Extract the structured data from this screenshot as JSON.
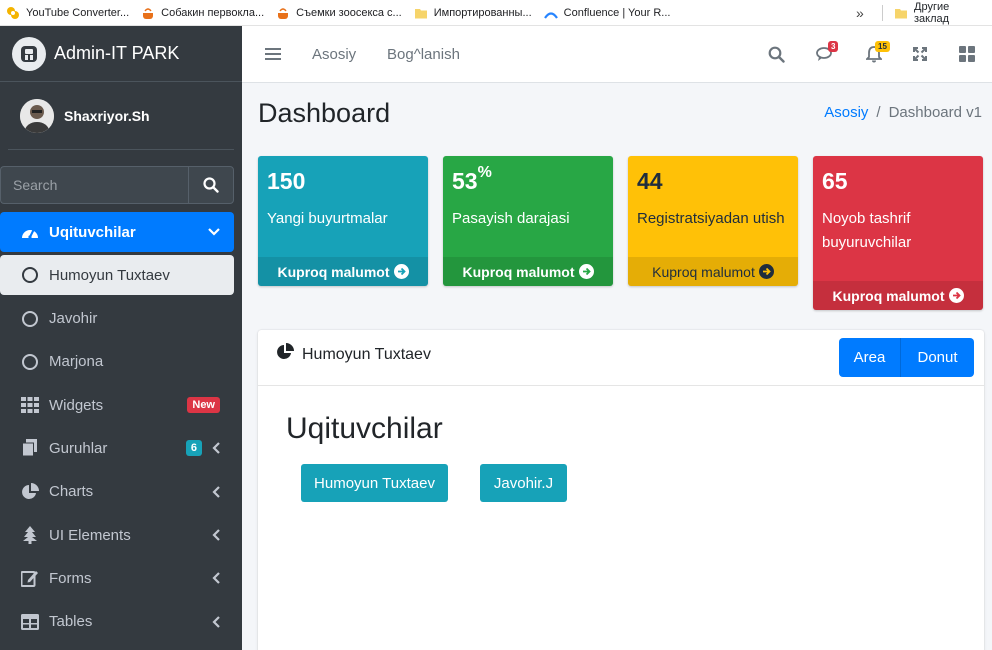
{
  "bookmarks": [
    {
      "label": "YouTube Converter...",
      "icon": "youtube-converter-icon"
    },
    {
      "label": "Собакин первокла...",
      "icon": "cooking-pot-icon"
    },
    {
      "label": "Съемки зоосекса с...",
      "icon": "cooking-pot-icon"
    },
    {
      "label": "Импортированны...",
      "icon": "folder-icon"
    },
    {
      "label": "Confluence | Your R...",
      "icon": "confluence-icon"
    }
  ],
  "bookmarks_more": "»",
  "bookmarks_other": "Другие заклад",
  "brand": {
    "name": "Admin-IT PARK"
  },
  "user": {
    "name": "Shaxriyor.Sh"
  },
  "search": {
    "placeholder": "Search"
  },
  "sidebar": {
    "items": [
      {
        "label": "Uqituvchilar",
        "icon": "tachometer-icon",
        "state": "active"
      },
      {
        "label": "Humoyun Tuxtaev",
        "icon": "circle-icon",
        "state": "sub-active"
      },
      {
        "label": "Javohir",
        "icon": "circle-icon"
      },
      {
        "label": "Marjona",
        "icon": "circle-icon"
      },
      {
        "label": "Widgets",
        "icon": "th-grid-icon",
        "badge": "New"
      },
      {
        "label": "Guruhlar",
        "icon": "copy-icon",
        "badge": "6"
      },
      {
        "label": "Charts",
        "icon": "pie-chart-icon"
      },
      {
        "label": "UI Elements",
        "icon": "tree-icon"
      },
      {
        "label": "Forms",
        "icon": "edit-icon"
      },
      {
        "label": "Tables",
        "icon": "table-icon"
      }
    ]
  },
  "topnav": {
    "links": [
      "Asosiy",
      "Bog^lanish"
    ],
    "messages_count": "3",
    "notifications_count": "15"
  },
  "page": {
    "title": "Dashboard",
    "breadcrumb": [
      "Asosiy",
      "Dashboard v1"
    ]
  },
  "boxes": [
    {
      "value": "150",
      "label": "Yangi buyurtmalar",
      "more": "Kuproq malumot",
      "color": "#17a2b8"
    },
    {
      "value": "53",
      "suffix": "%",
      "label": "Pasayish darajasi",
      "more": "Kuproq malumot",
      "color": "#28a745"
    },
    {
      "value": "44",
      "label": "Registratsiyadan utish",
      "more": "Kuproq malumot",
      "color": "#ffc107"
    },
    {
      "value": "65",
      "label": "Noyob tashrif buyuruvchilar",
      "more": "Kuproq malumot",
      "color": "#dc3545"
    }
  ],
  "card": {
    "title": "Humoyun Tuxtaev",
    "tabs": [
      "Area",
      "Donut"
    ],
    "heading": "Uqituvchilar",
    "teachers": [
      "Humoyun Tuxtaev",
      "Javohir.J"
    ]
  },
  "colors": {
    "primary": "#007bff",
    "sidebar": "#343a40",
    "info": "#17a2b8",
    "success": "#28a745",
    "warning": "#ffc107",
    "danger": "#dc3545"
  }
}
